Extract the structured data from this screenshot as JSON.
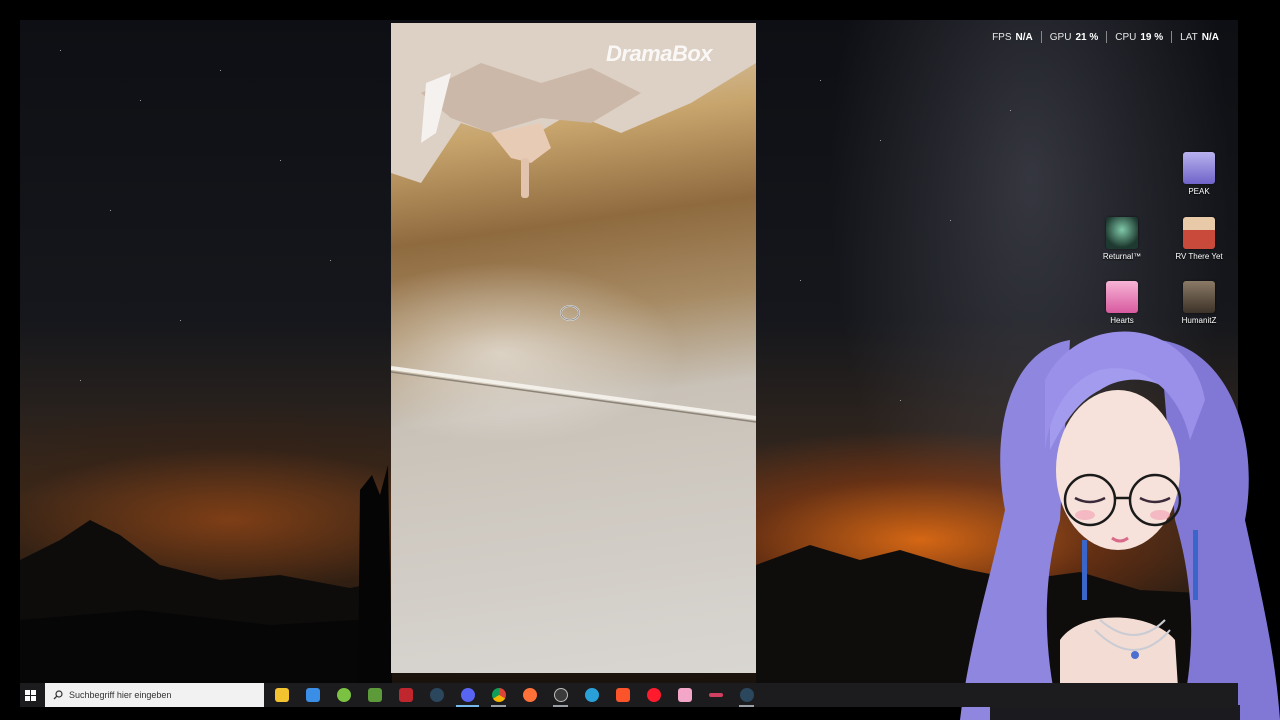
{
  "video": {
    "watermark": "DramaBox"
  },
  "performance_overlay": [
    {
      "label": "FPS",
      "value": "N/A"
    },
    {
      "label": "GPU",
      "value": "21 %"
    },
    {
      "label": "CPU",
      "value": "19 %"
    },
    {
      "label": "LAT",
      "value": "N/A"
    }
  ],
  "desktop_icons": [
    {
      "label": "PEAK",
      "icon": "peak-game-icon",
      "color": "#8d7fd6"
    },
    {
      "label": "Returnal™",
      "icon": "returnal-game-icon",
      "color": "#2f5a4a"
    },
    {
      "label": "RV There Yet",
      "icon": "rv-there-yet-game-icon",
      "color": "#c94a3a"
    },
    {
      "label": "Hearts",
      "icon": "hearts-game-icon",
      "color": "#e07ab8"
    },
    {
      "label": "HumanitZ",
      "icon": "humanitz-game-icon",
      "color": "#5a4a3a"
    }
  ],
  "taskbar": {
    "search_placeholder": "Suchbegriff hier eingeben",
    "apps": [
      {
        "name": "file-explorer",
        "color": "#f4c430"
      },
      {
        "name": "microsoft-store",
        "color": "#3a8ee6"
      },
      {
        "name": "android-app",
        "color": "#7cc242"
      },
      {
        "name": "minecraft",
        "color": "#5d9b3a"
      },
      {
        "name": "obs-source-app",
        "color": "#c0262d"
      },
      {
        "name": "steam",
        "color": "#2a475e"
      },
      {
        "name": "discord",
        "color": "#5865f2"
      },
      {
        "name": "chrome",
        "color": "#db4437"
      },
      {
        "name": "firefox",
        "color": "#ff7139"
      },
      {
        "name": "obs-studio",
        "color": "#3b3b3b"
      },
      {
        "name": "edge-app",
        "color": "#2aa0d8"
      },
      {
        "name": "brave",
        "color": "#fb542b"
      },
      {
        "name": "opera",
        "color": "#ff1b2d"
      },
      {
        "name": "vtube-app",
        "color": "#f3a6c8"
      },
      {
        "name": "streamer-app",
        "color": "#d04060"
      },
      {
        "name": "steam-secondary",
        "color": "#2a475e"
      }
    ]
  }
}
